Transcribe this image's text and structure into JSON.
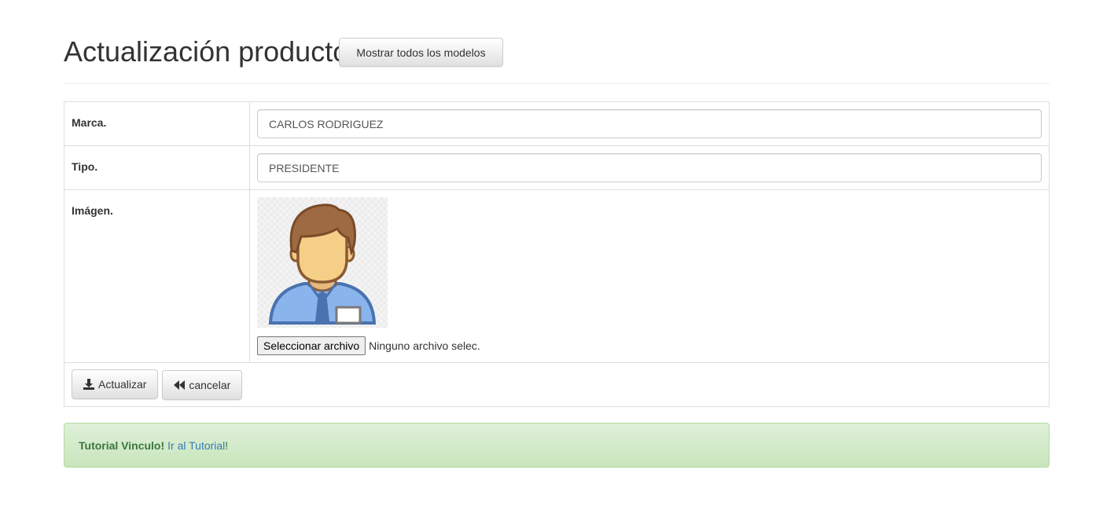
{
  "header": {
    "title": "Actualización producto.",
    "show_models_label": "Mostrar todos los modelos"
  },
  "form": {
    "marca": {
      "label": "Marca.",
      "value": "CARLOS RODRIGUEZ"
    },
    "tipo": {
      "label": "Tipo.",
      "value": "PRESIDENTE"
    },
    "imagen": {
      "label": "Imágen.",
      "file_button_label": "Seleccionar archivo",
      "file_status": "Ninguno archivo selec."
    }
  },
  "actions": {
    "update_label": "Actualizar",
    "cancel_label": "cancelar"
  },
  "alert": {
    "strong_text": "Tutorial Vinculo!",
    "link_text": "Ir al Tutorial",
    "trailing_text": "!"
  },
  "icons": {
    "update": "download-icon",
    "cancel": "fast-backward-icon",
    "avatar": "businessman-avatar"
  },
  "colors": {
    "alert_text": "#3c763d",
    "link": "#337ab7",
    "alert_bg": "#dff0d8"
  }
}
